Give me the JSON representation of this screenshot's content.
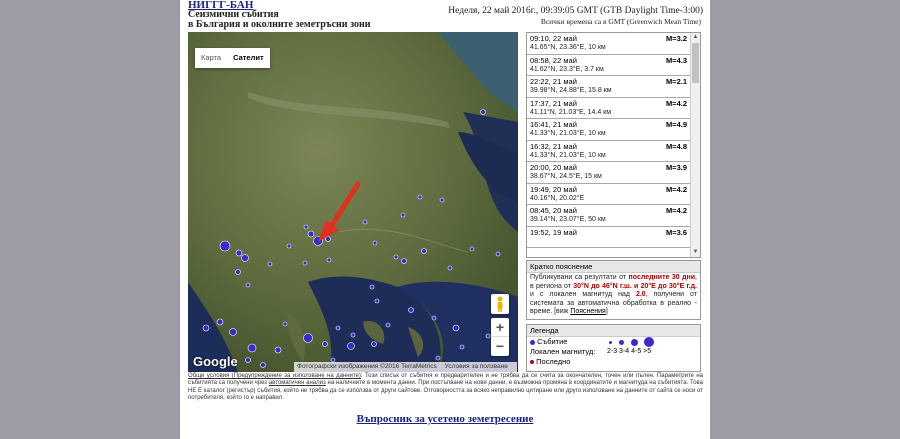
{
  "header": {
    "org_link": "НИГГГ-БАН",
    "title_line1": "Сеизмични събития",
    "title_line2": "в България и околните земетръсни зони",
    "datetime": "Неделя, 22 май 2016г., 09:39:05 GMT (GTB Daylight Time-3:00)",
    "gmt_note": "Всички времена са в GMT (Greenwich Mean Time)"
  },
  "map": {
    "tab_map": "Карта",
    "tab_satellite": "Сателит",
    "zoom_in": "+",
    "zoom_out": "−",
    "google_logo": "Google",
    "attribution_imagery": "Фотографски изображения ©2016 TerraMetrics",
    "attribution_terms": "Условия за ползване",
    "event_color": "#3a2acb",
    "arrow_color": "#e0301e"
  },
  "quakes": [
    {
      "time": "09:10, 22 май",
      "mag": "M=3.2",
      "loc": "41.65°N, 23.36°E, 10 км"
    },
    {
      "time": "08:58, 22 май",
      "mag": "M=4.3",
      "loc": "41.62°N, 23.3°E, 3.7 км"
    },
    {
      "time": "22:22, 21 май",
      "mag": "M=2.1",
      "loc": "39.98°N, 24.88°E, 15.8 км"
    },
    {
      "time": "17:37, 21 май",
      "mag": "M=4.2",
      "loc": "41.11°N, 21.03°E, 14.4 км"
    },
    {
      "time": "16:41, 21 май",
      "mag": "M=4.9",
      "loc": "41.33°N, 21.03°E, 10 км"
    },
    {
      "time": "16:32, 21 май",
      "mag": "M=4.8",
      "loc": "41.33°N, 21.03°E, 10 км"
    },
    {
      "time": "20:00, 20 май",
      "mag": "M=3.9",
      "loc": "38.67°N, 24.5°E, 15 км"
    },
    {
      "time": "19:49, 20 май",
      "mag": "M=4.2",
      "loc": "40.16°N, 20.02°E"
    },
    {
      "time": "08:45, 20 май",
      "mag": "M=4.2",
      "loc": "39.14°N, 23.07°E, 50 км"
    },
    {
      "time": "19:52, 19 май",
      "mag": "M=3.6",
      "loc": ""
    }
  ],
  "explanation": {
    "title": "Кратко пояснение",
    "p1": "Публикувани са резултати от ",
    "red1": "последните 30 дни",
    "p2": ", в региона от ",
    "red2": "30°N до 46°N г.ш. и 20°E до 30°E г.д.",
    "p3": " и с локален магнитуд над ",
    "red3": "2.0",
    "p4": ", получени от системата за автоматична обработка в реално - време. [виж ",
    "link": "Пояснения",
    "p5": "]"
  },
  "legend": {
    "title": "Легенда",
    "event_label": "Събитие",
    "magnitude_label": "Локален магнитуд:",
    "magnitudes": "2-3 3-4 4-5 >5",
    "last_label": "Последно"
  },
  "disclaimer": {
    "link1": "Общи условия (Предупреждение за използване на данните)",
    "text1": ": Този списък от събития е предварителен и не трябва да се счита за окончателен, точен или пълен. Параметрите на събитията са получени чрез ",
    "link2": "автоматичен анализ",
    "text2": " на наличните в момента данни. При постъпване на нови данни, е възможна промяна в координатите и магнитуда на събитията. Това НЕ Е каталог (регистър) събития, който не трябва да се използва от други сайтове. Отговорността за всяко неправилно цитиране или друго използване на данните от сайта се носи от потребителя, който го е направил."
  },
  "survey_link": "Въпросник за усетено земетресение"
}
